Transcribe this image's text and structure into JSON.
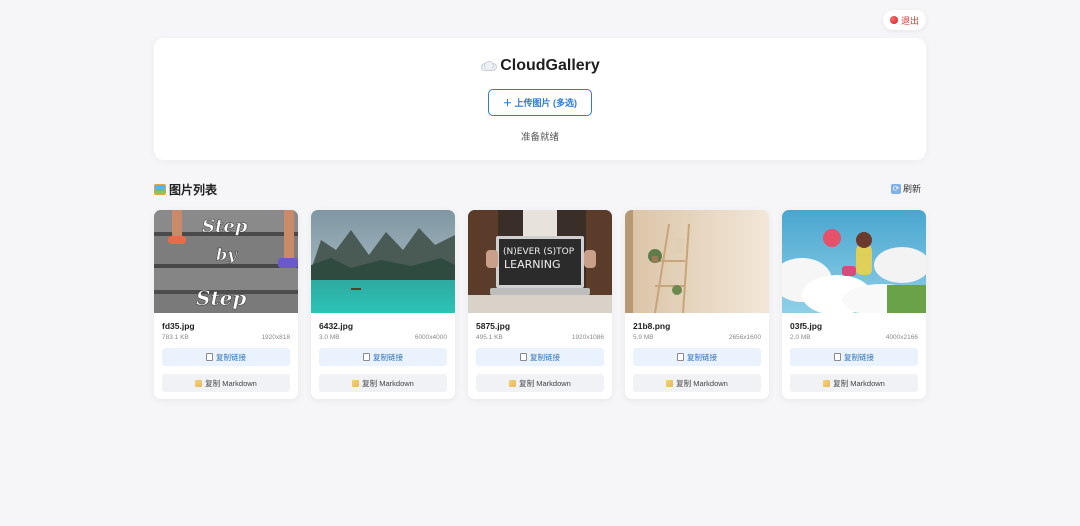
{
  "header": {
    "logout_label": "退出"
  },
  "upload": {
    "app_title": "CloudGallery",
    "upload_button_label": "＋ 上传图片 (多选)",
    "status_text": "准备就绪"
  },
  "gallery": {
    "section_title": "图片列表",
    "refresh_label": "刷新",
    "copy_link_label": "复制链接",
    "copy_markdown_label": "复制 Markdown",
    "images": [
      {
        "name": "fd35.jpg",
        "size": "783.1 KB",
        "dimensions": "1920x818",
        "subject": "steps with chalk text Step by Step"
      },
      {
        "name": "6432.jpg",
        "size": "3.0 MB",
        "dimensions": "6000x4000",
        "subject": "mountain lake with boat"
      },
      {
        "name": "5875.jpg",
        "size": "495.1 KB",
        "dimensions": "1920x1086",
        "subject": "laptop showing (N)EVER (S)TOP LEARNING"
      },
      {
        "name": "21b8.png",
        "size": "5.9 MB",
        "dimensions": "2656x1600",
        "subject": "beige room with ladder shelf and plant"
      },
      {
        "name": "03f5.jpg",
        "size": "2.0 MB",
        "dimensions": "4000x2166",
        "subject": "anime girl among clouds"
      }
    ],
    "thumbnail_text": {
      "card0": [
        "Step",
        "by",
        "Step"
      ],
      "card2": [
        "(N)EVER (S)TOP",
        "LEARNING"
      ]
    }
  }
}
